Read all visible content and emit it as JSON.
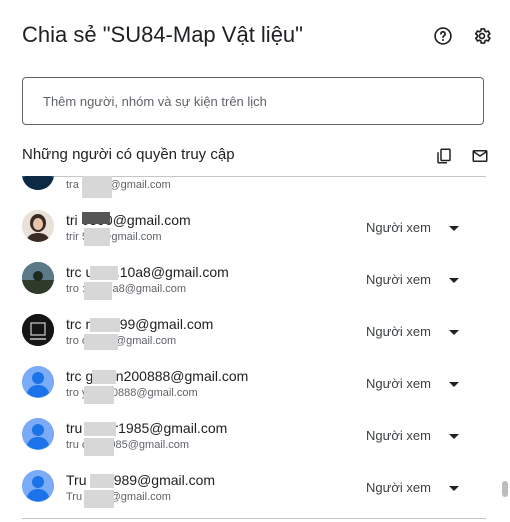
{
  "dialog": {
    "title": "Chia sẻ \"SU84-Map Vật liệu\"",
    "add_placeholder": "Thêm người, nhóm và sự kiện trên lịch",
    "section_title": "Những người có quyền truy cập"
  },
  "colors": {
    "accent": "#1a73e8",
    "default_avatar": "#7baaf7"
  },
  "people": [
    {
      "email": "",
      "sub": "tra          am84@gmail.com",
      "role": ""
    },
    {
      "email": "tri      0590@gmail.com",
      "sub": "trir       590@gmail.com",
      "role": "Người xem"
    },
    {
      "email": "trc      uc10.10a8@gmail.com",
      "sub": "tro      :10.10a8@gmail.com",
      "role": "Người xem"
    },
    {
      "email": "trc       noale99@gmail.com",
      "sub": "tro        oale99@gmail.com",
      "role": "Người xem"
    },
    {
      "email": "trc       guyen200888@gmail.com",
      "sub": "tro      yen200888@gmail.com",
      "role": "Người xem"
    },
    {
      "email": "tru       rch.fr1985@gmail.com",
      "sub": "tru      ch.fr1985@gmail.com",
      "role": "Người xem"
    },
    {
      "email": "Tru      nh8989@gmail.com",
      "sub": "Tru      8989@gmail.com",
      "role": "Người xem"
    }
  ]
}
